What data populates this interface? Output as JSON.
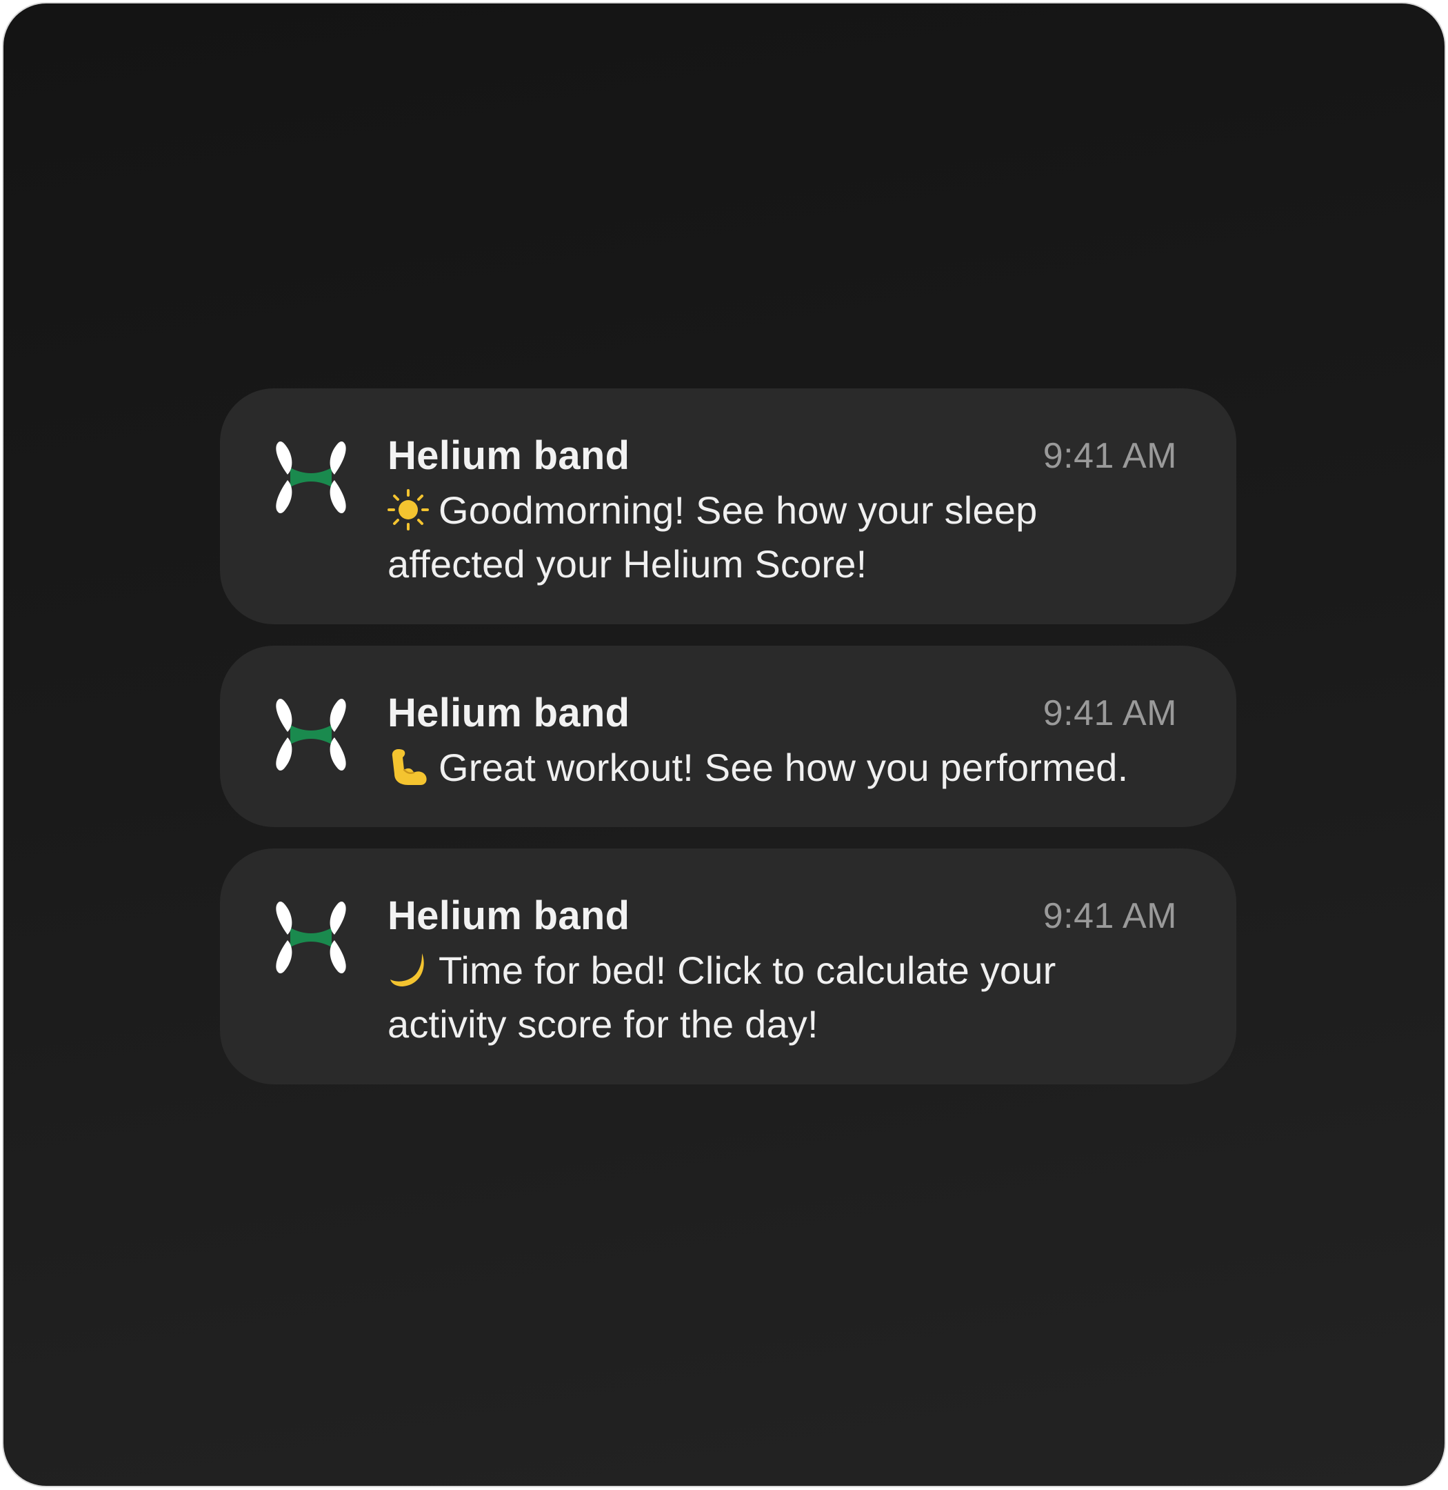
{
  "colors": {
    "background": "#1a1a1a",
    "card": "#2a2a2a",
    "brand_green": "#1a8a4e",
    "text_primary": "#f2f2f2",
    "text_secondary": "#9a9a9a",
    "emoji_yellow": "#f4c430"
  },
  "notifications": [
    {
      "app_name": "Helium band",
      "time": "9:41 AM",
      "icon": "sun-icon",
      "message": "Goodmorning! See how your sleep affected your Helium Score!"
    },
    {
      "app_name": "Helium band",
      "time": "9:41 AM",
      "icon": "flexed-biceps-icon",
      "message": "Great workout! See how you performed."
    },
    {
      "app_name": "Helium band",
      "time": "9:41 AM",
      "icon": "crescent-moon-icon",
      "message": "Time for bed! Click to calculate your activity score for the day!"
    }
  ]
}
